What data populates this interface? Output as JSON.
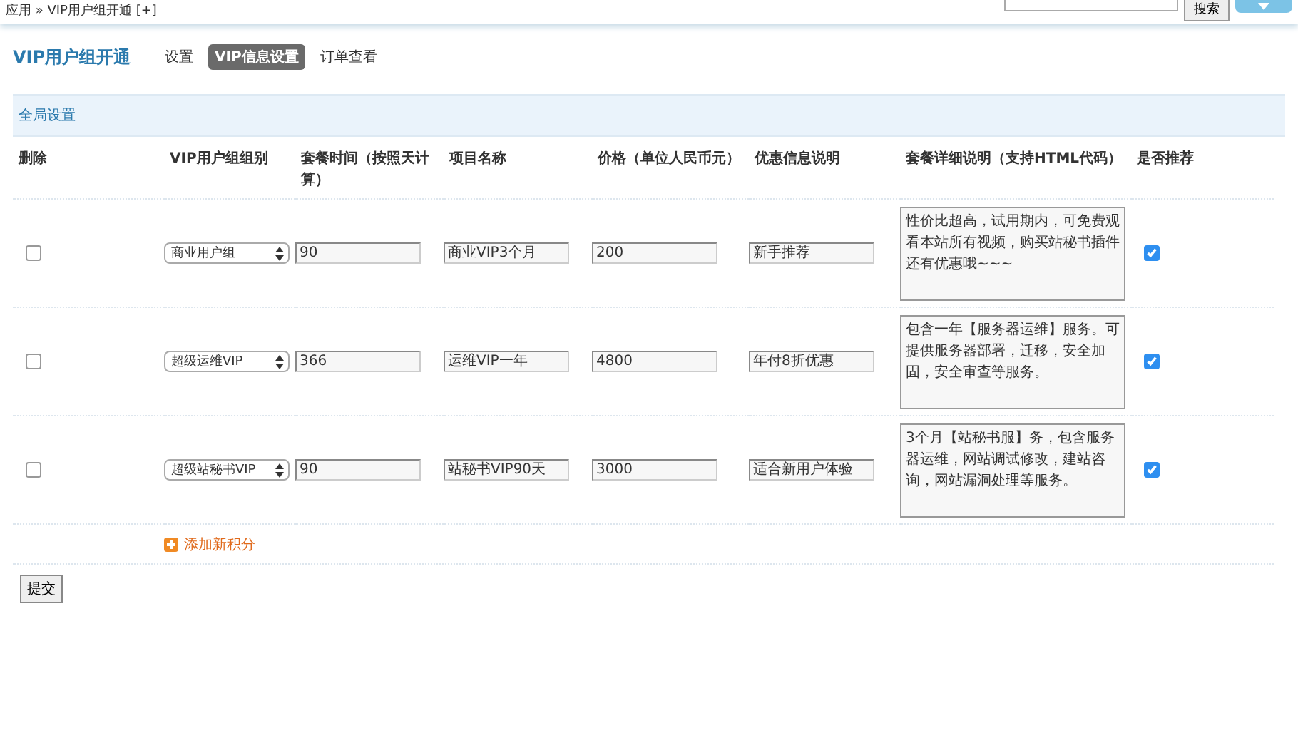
{
  "top_bar": {
    "breadcrumb": "应用 » VIP用户组开通 [+]",
    "search_button": "搜索"
  },
  "header": {
    "title": "VIP用户组开通",
    "tabs": [
      {
        "label": "设置",
        "selected": false
      },
      {
        "label": "VIP信息设置",
        "selected": true
      },
      {
        "label": "订单查看",
        "selected": false
      }
    ]
  },
  "section_title": "全局设置",
  "table": {
    "columns": [
      "删除",
      "VIP用户组组别",
      "套餐时间（按照天计算）",
      "项目名称",
      "价格（单位人民币元）",
      "优惠信息说明",
      "套餐详细说明（支持HTML代码）",
      "是否推荐"
    ],
    "rows": [
      {
        "delete": false,
        "group": "商业用户组",
        "days": "90",
        "name": "商业VIP3个月",
        "price": "200",
        "offer": "新手推荐",
        "detail": "性价比超高，试用期内，可免费观看本站所有视频，购买站秘书插件还有优惠哦~~~",
        "recommended": true
      },
      {
        "delete": false,
        "group": "超级运维VIP",
        "days": "366",
        "name": "运维VIP一年",
        "price": "4800",
        "offer": "年付8折优惠",
        "detail": "包含一年【服务器运维】服务。可提供服务器部署，迁移，安全加固，安全审查等服务。",
        "recommended": true
      },
      {
        "delete": false,
        "group": "超级站秘书VIP",
        "days": "90",
        "name": "站秘书VIP90天",
        "price": "3000",
        "offer": "适合新用户体验",
        "detail": "3个月【站秘书服】务，包含服务器运维，网站调试修改，建站咨询，网站漏洞处理等服务。",
        "recommended": true
      }
    ],
    "add_link": "添加新积分"
  },
  "submit": "提交"
}
